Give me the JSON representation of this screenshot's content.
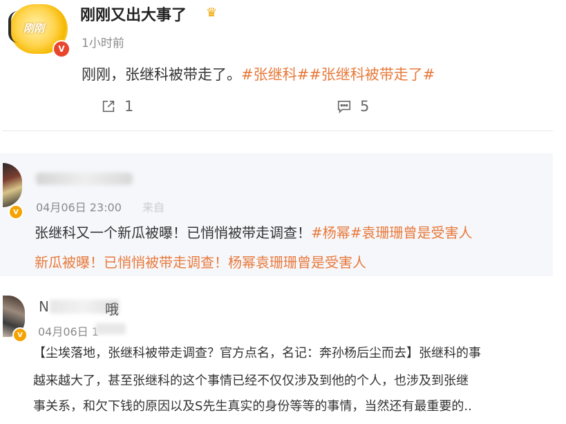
{
  "post1": {
    "author": "刚刚又出大事了",
    "avatar_text": "刚刚",
    "badge": "V",
    "time": "1小时前",
    "text": "刚刚，张继科被带走了。",
    "tags": "#张继科##张继科被带走了#",
    "repost_count": "1",
    "comment_count": "5",
    "icons": {
      "repost": "share-icon",
      "comment": "comment-icon",
      "crown": "crown-icon"
    }
  },
  "post2": {
    "time": "04月06日 23:00",
    "source": "来自",
    "badge": "V",
    "line1_plain": "张继科又一个新瓜被曝！已悄悄被带走调查！",
    "line1_tag": "#杨幂#袁珊珊曾是受害人",
    "line2": "新瓜被曝！已悄悄被带走调查！杨幂袁珊珊曾是受害人"
  },
  "post3": {
    "name_visible": "N",
    "name_tail": "哦",
    "time": "04月06日 1",
    "badge": "V",
    "lines": [
      "【尘埃落地，张继科被带走调查？官方点名，名记：奔孙杨后尘而去】张继科的事",
      "越来越大了，甚至张继科的这个事情已经不仅仅涉及到他的个人，也涉及到张继",
      "事关系，和欠下钱的原因以及S先生真实的身份等等的事情，当然还有最重要的.."
    ]
  },
  "colors": {
    "tag": "#e8793b",
    "badge_gold": "#f5a300",
    "badge_red": "#e8452c"
  }
}
